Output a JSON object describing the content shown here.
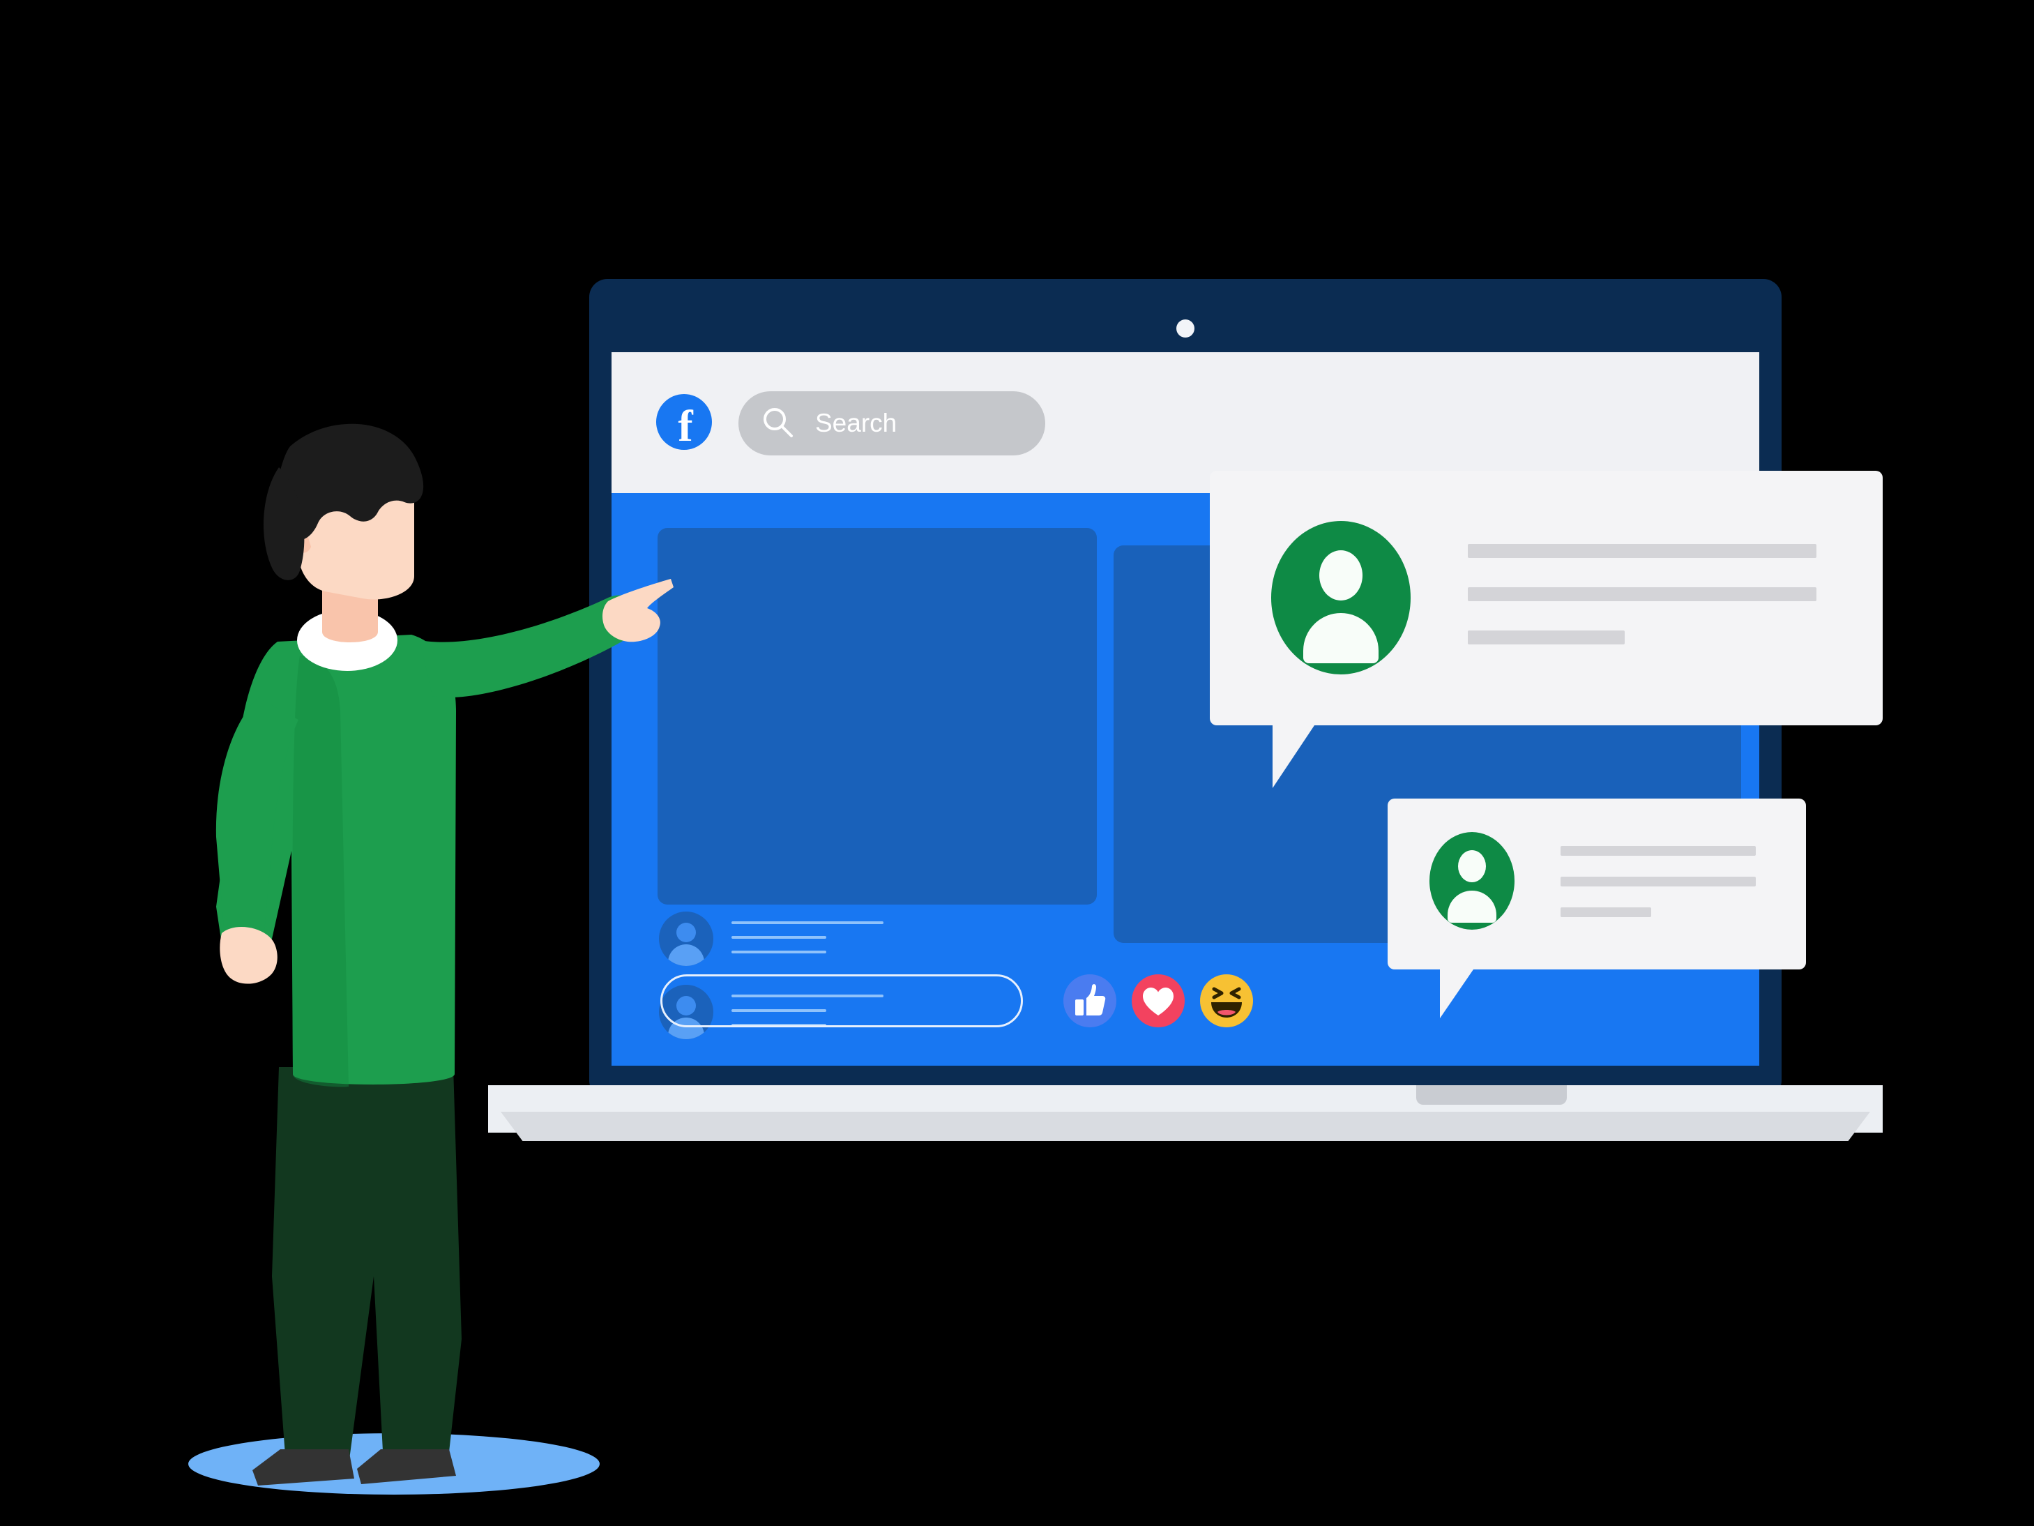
{
  "scene": {
    "title": "Facebook social media illustration",
    "background_color": "#000000",
    "accent_blue": "#1877f2",
    "accent_green": "#0e8a45",
    "bezel_navy": "#0b2c52"
  },
  "laptop": {
    "name": "laptop",
    "bezel_color": "#0b2c52",
    "base_color": "#eceff3",
    "webcam": {
      "name": "webcam",
      "color": "#f2f4f8"
    },
    "trackpad_notch": {
      "name": "trackpad-notch",
      "color": "#c9ccd2"
    }
  },
  "app": {
    "name": "Facebook",
    "header": {
      "background": "#f0f1f4",
      "logo": {
        "icon": "facebook-logo-icon",
        "glyph": "f",
        "background": "#1877f2",
        "foreground": "#ffffff"
      },
      "search": {
        "icon": "search-icon",
        "placeholder": "Search",
        "value": "",
        "background": "#c5c7cb",
        "text_color": "#ffffff"
      }
    },
    "feed": {
      "background": "#1877f2",
      "post_placeholders": [
        {
          "name": "post-image-placeholder",
          "color": "#1961ba"
        },
        {
          "name": "post-image-placeholder-secondary",
          "color": "#1961ba"
        }
      ],
      "items": [
        {
          "name": "feed-list-item",
          "avatar_icon": "user-avatar-icon",
          "avatar_color": "#1b62bb",
          "lines": 3
        },
        {
          "name": "feed-list-item",
          "avatar_icon": "user-avatar-icon",
          "avatar_color": "#1b62bb",
          "lines": 3
        }
      ],
      "comment_input": {
        "name": "comment-input",
        "placeholder": "",
        "value": "",
        "border_color": "#e7f0fd"
      },
      "reactions": [
        {
          "name": "reaction-like",
          "icon": "thumbs-up-icon",
          "label": "Like",
          "color": "#4a7cf0"
        },
        {
          "name": "reaction-love",
          "icon": "heart-icon",
          "label": "Love",
          "color": "#f3425f"
        },
        {
          "name": "reaction-haha",
          "icon": "laughing-face-icon",
          "label": "Haha",
          "color": "#f7c133"
        }
      ]
    },
    "chat_bubbles": [
      {
        "name": "chat-bubble-primary",
        "avatar_icon": "user-avatar-icon",
        "avatar_color": "#0e8a45",
        "background": "#f4f4f6",
        "message_lines": 3
      },
      {
        "name": "chat-bubble-secondary",
        "avatar_icon": "user-avatar-icon",
        "avatar_color": "#0e8a45",
        "background": "#f4f4f6",
        "message_lines": 3
      }
    ]
  },
  "character": {
    "name": "person-pointing",
    "pose": "pointing at screen with right hand, left hand on hip",
    "hair_color": "#1c1c1c",
    "skin_color": "#fcd9c4",
    "sweater_color": "#1d9e4e",
    "sweater_shadow": "#148a41",
    "collar_color": "#ffffff",
    "pants_color": "#12381f",
    "shoes_color": "#333333",
    "ground_shadow_color": "#6fb2f7"
  }
}
